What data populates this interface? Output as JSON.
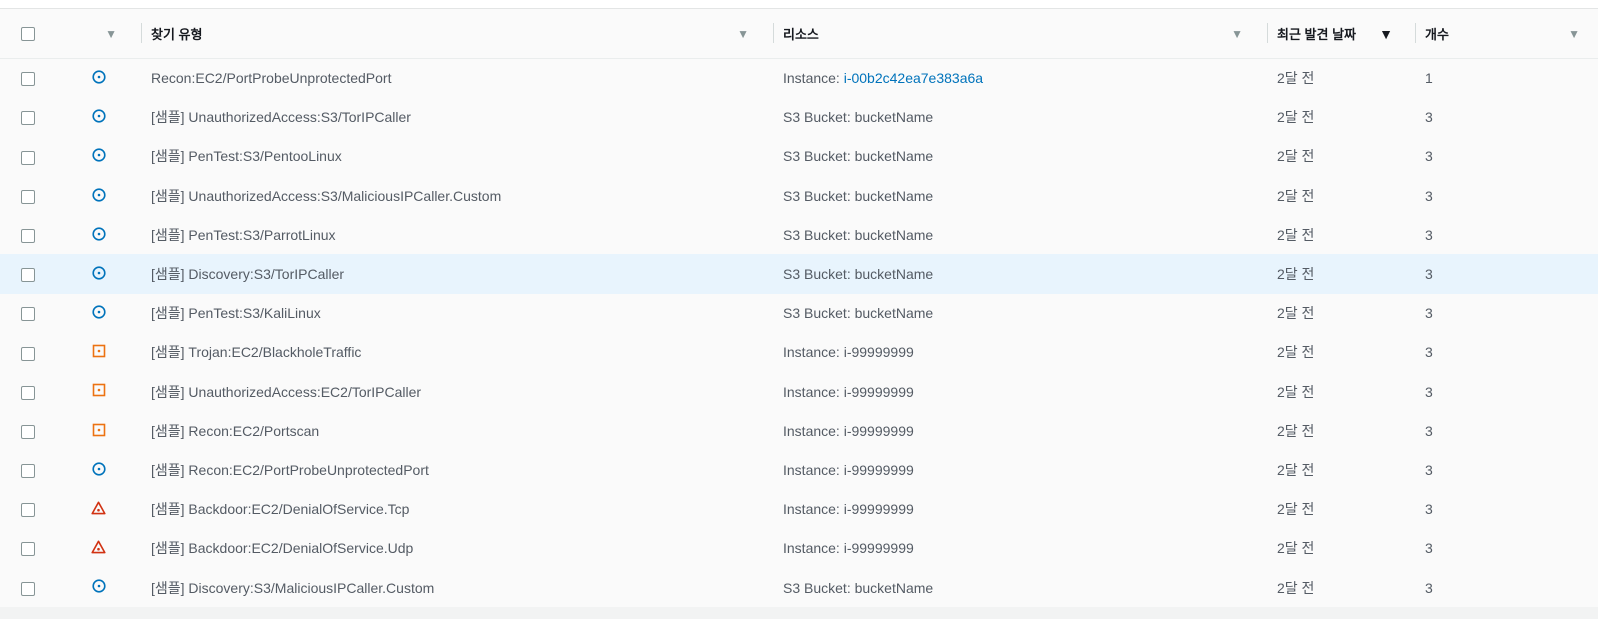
{
  "columns": {
    "severity_sort": "▼",
    "finding_type": "찾기 유형",
    "resource": "리소스",
    "last_seen": "최근 발견 날짜",
    "count": "개수",
    "sort_icon": "▼"
  },
  "colors": {
    "low": "#0073bb",
    "medium": "#ec7211",
    "high": "#d13212"
  },
  "rows": [
    {
      "severity": "low",
      "icon": "low-severity-icon",
      "finding": "Recon:EC2/PortProbeUnprotectedPort",
      "resource_prefix": "Instance: ",
      "resource_value": "i-00b2c42ea7e383a6a",
      "resource_link": true,
      "last_seen": "2달 전",
      "count": "1"
    },
    {
      "severity": "low",
      "icon": "low-severity-icon",
      "finding": "[샘플] UnauthorizedAccess:S3/TorIPCaller",
      "resource_prefix": "S3 Bucket: ",
      "resource_value": "bucketName",
      "resource_link": false,
      "last_seen": "2달 전",
      "count": "3"
    },
    {
      "severity": "low",
      "icon": "low-severity-icon",
      "finding": "[샘플] PenTest:S3/PentooLinux",
      "resource_prefix": "S3 Bucket: ",
      "resource_value": "bucketName",
      "resource_link": false,
      "last_seen": "2달 전",
      "count": "3"
    },
    {
      "severity": "low",
      "icon": "low-severity-icon",
      "finding": "[샘플] UnauthorizedAccess:S3/MaliciousIPCaller.Custom",
      "resource_prefix": "S3 Bucket: ",
      "resource_value": "bucketName",
      "resource_link": false,
      "last_seen": "2달 전",
      "count": "3"
    },
    {
      "severity": "low",
      "icon": "low-severity-icon",
      "finding": "[샘플] PenTest:S3/ParrotLinux",
      "resource_prefix": "S3 Bucket: ",
      "resource_value": "bucketName",
      "resource_link": false,
      "last_seen": "2달 전",
      "count": "3"
    },
    {
      "severity": "low",
      "icon": "low-severity-icon",
      "finding": "[샘플] Discovery:S3/TorIPCaller",
      "resource_prefix": "S3 Bucket: ",
      "resource_value": "bucketName",
      "resource_link": false,
      "last_seen": "2달 전",
      "count": "3",
      "highlight": true
    },
    {
      "severity": "low",
      "icon": "low-severity-icon",
      "finding": "[샘플] PenTest:S3/KaliLinux",
      "resource_prefix": "S3 Bucket: ",
      "resource_value": "bucketName",
      "resource_link": false,
      "last_seen": "2달 전",
      "count": "3"
    },
    {
      "severity": "medium",
      "icon": "medium-severity-icon",
      "finding": "[샘플] Trojan:EC2/BlackholeTraffic",
      "resource_prefix": "Instance: ",
      "resource_value": "i-99999999",
      "resource_link": false,
      "last_seen": "2달 전",
      "count": "3"
    },
    {
      "severity": "medium",
      "icon": "medium-severity-icon",
      "finding": "[샘플] UnauthorizedAccess:EC2/TorIPCaller",
      "resource_prefix": "Instance: ",
      "resource_value": "i-99999999",
      "resource_link": false,
      "last_seen": "2달 전",
      "count": "3"
    },
    {
      "severity": "medium",
      "icon": "medium-severity-icon",
      "finding": "[샘플] Recon:EC2/Portscan",
      "resource_prefix": "Instance: ",
      "resource_value": "i-99999999",
      "resource_link": false,
      "last_seen": "2달 전",
      "count": "3"
    },
    {
      "severity": "low",
      "icon": "low-severity-icon",
      "finding": "[샘플] Recon:EC2/PortProbeUnprotectedPort",
      "resource_prefix": "Instance: ",
      "resource_value": "i-99999999",
      "resource_link": false,
      "last_seen": "2달 전",
      "count": "3"
    },
    {
      "severity": "high",
      "icon": "high-severity-icon",
      "finding": "[샘플] Backdoor:EC2/DenialOfService.Tcp",
      "resource_prefix": "Instance: ",
      "resource_value": "i-99999999",
      "resource_link": false,
      "last_seen": "2달 전",
      "count": "3"
    },
    {
      "severity": "high",
      "icon": "high-severity-icon",
      "finding": "[샘플] Backdoor:EC2/DenialOfService.Udp",
      "resource_prefix": "Instance: ",
      "resource_value": "i-99999999",
      "resource_link": false,
      "last_seen": "2달 전",
      "count": "3"
    },
    {
      "severity": "low",
      "icon": "low-severity-icon",
      "finding": "[샘플] Discovery:S3/MaliciousIPCaller.Custom",
      "resource_prefix": "S3 Bucket: ",
      "resource_value": "bucketName",
      "resource_link": false,
      "last_seen": "2달 전",
      "count": "3"
    }
  ]
}
